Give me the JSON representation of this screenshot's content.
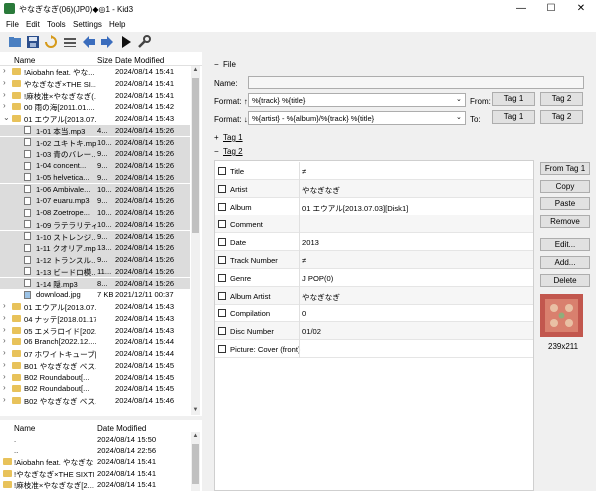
{
  "window": {
    "title": "やなぎなぎ(06)(JP0)◆◎1 - Kid3",
    "minimize": "—",
    "maximize": "☐",
    "close": "✕"
  },
  "menu": [
    "File",
    "Edit",
    "Tools",
    "Settings",
    "Help"
  ],
  "toolbar_icons": [
    "open-folder-icon",
    "save-icon",
    "revert-icon",
    "file-list-icon",
    "previous-icon",
    "next-icon",
    "play-icon",
    "settings-wrench-icon"
  ],
  "file_tree": {
    "headers": {
      "name": "Name",
      "size": "Size",
      "date": "Date Modified"
    },
    "rows": [
      {
        "name": "!Aiobahn feat. やな...",
        "size": "",
        "date": "2024/08/14 15:41",
        "type": "folder",
        "indent": 0,
        "expander": "›",
        "selected": false
      },
      {
        "name": "やなぎなぎ×THE SI...",
        "size": "",
        "date": "2024/08/14 15:41",
        "type": "folder",
        "indent": 0,
        "expander": "›",
        "selected": false
      },
      {
        "name": "!麻枝准×やなぎなぎ(...",
        "size": "",
        "date": "2024/08/14 15:41",
        "type": "folder",
        "indent": 0,
        "expander": "›",
        "selected": false
      },
      {
        "name": "00 雨の海[2011.01....",
        "size": "",
        "date": "2024/08/14 15:42",
        "type": "folder",
        "indent": 0,
        "expander": "›",
        "selected": false
      },
      {
        "name": "01 エウアル[2013.07....",
        "size": "",
        "date": "2024/08/14 15:43",
        "type": "folder",
        "indent": 0,
        "expander": "⌄",
        "selected": false
      },
      {
        "name": "1-01 本当.mp3",
        "size": "4...",
        "date": "2024/08/14 15:26",
        "type": "file",
        "indent": 1,
        "expander": "",
        "selected": true
      },
      {
        "name": "1-02 ユキトキ.mp3",
        "size": "10...",
        "date": "2024/08/14 15:26",
        "type": "file",
        "indent": 1,
        "expander": "",
        "selected": true
      },
      {
        "name": "1-03 青のバレー...",
        "size": "9...",
        "date": "2024/08/14 15:26",
        "type": "file",
        "indent": 1,
        "expander": "",
        "selected": true
      },
      {
        "name": "1-04 concent...",
        "size": "9...",
        "date": "2024/08/14 15:26",
        "type": "file",
        "indent": 1,
        "expander": "",
        "selected": true
      },
      {
        "name": "1-05 helvetica...",
        "size": "9...",
        "date": "2024/08/14 15:26",
        "type": "file",
        "indent": 1,
        "expander": "",
        "selected": true
      },
      {
        "name": "1-06 Ambivale...",
        "size": "10...",
        "date": "2024/08/14 15:26",
        "type": "file",
        "indent": 1,
        "expander": "",
        "selected": true
      },
      {
        "name": "1-07 euaru.mp3",
        "size": "9...",
        "date": "2024/08/14 15:26",
        "type": "file",
        "indent": 1,
        "expander": "",
        "selected": true
      },
      {
        "name": "1-08 Zoetrope...",
        "size": "10...",
        "date": "2024/08/14 15:26",
        "type": "file",
        "indent": 1,
        "expander": "",
        "selected": true
      },
      {
        "name": "1-09 ラテラリティ...",
        "size": "10...",
        "date": "2024/08/14 15:26",
        "type": "file",
        "indent": 1,
        "expander": "",
        "selected": true
      },
      {
        "name": "1-10 ストレンジ...",
        "size": "9...",
        "date": "2024/08/14 15:26",
        "type": "file",
        "indent": 1,
        "expander": "",
        "selected": true
      },
      {
        "name": "1-11 クオリア.mp3",
        "size": "13...",
        "date": "2024/08/14 15:26",
        "type": "file",
        "indent": 1,
        "expander": "",
        "selected": true
      },
      {
        "name": "1-12 トランスル...",
        "size": "9...",
        "date": "2024/08/14 15:26",
        "type": "file",
        "indent": 1,
        "expander": "",
        "selected": true
      },
      {
        "name": "1-13 ビードロ模...",
        "size": "11...",
        "date": "2024/08/14 15:26",
        "type": "file",
        "indent": 1,
        "expander": "",
        "selected": true
      },
      {
        "name": "1-14 隠.mp3",
        "size": "8...",
        "date": "2024/08/14 15:26",
        "type": "file",
        "indent": 1,
        "expander": "",
        "selected": true
      },
      {
        "name": "download.jpg",
        "size": "7 KB",
        "date": "2021/12/11 00:37",
        "type": "image",
        "indent": 1,
        "expander": "",
        "selected": false
      },
      {
        "name": "01 エウアル[2013.07....",
        "size": "",
        "date": "2024/08/14 15:43",
        "type": "folder",
        "indent": 0,
        "expander": "›",
        "selected": false
      },
      {
        "name": "04 ナッテ[2018.01.17]",
        "size": "",
        "date": "2024/08/14 15:43",
        "type": "folder",
        "indent": 0,
        "expander": "›",
        "selected": false
      },
      {
        "name": "05 エメラロイド[202...",
        "size": "",
        "date": "2024/08/14 15:43",
        "type": "folder",
        "indent": 0,
        "expander": "›",
        "selected": false
      },
      {
        "name": "06 Branch[2022.12....",
        "size": "",
        "date": "2024/08/14 15:44",
        "type": "folder",
        "indent": 0,
        "expander": "›",
        "selected": false
      },
      {
        "name": "07 ホワイトキューブ[2...",
        "size": "",
        "date": "2024/08/14 15:44",
        "type": "folder",
        "indent": 0,
        "expander": "›",
        "selected": false
      },
      {
        "name": "B01 やなぎなぎ ベス...",
        "size": "",
        "date": "2024/08/14 15:45",
        "type": "folder",
        "indent": 0,
        "expander": "›",
        "selected": false
      },
      {
        "name": "B02 Roundabout[...",
        "size": "",
        "date": "2024/08/14 15:45",
        "type": "folder",
        "indent": 0,
        "expander": "›",
        "selected": false
      },
      {
        "name": "B02 Roundabout[...",
        "size": "",
        "date": "2024/08/14 15:45",
        "type": "folder",
        "indent": 0,
        "expander": "›",
        "selected": false
      },
      {
        "name": "B02 やなぎなぎ ベス...",
        "size": "",
        "date": "2024/08/14 15:46",
        "type": "folder",
        "indent": 0,
        "expander": "›",
        "selected": false
      }
    ]
  },
  "dir_list": {
    "headers": {
      "name": "Name",
      "date": "Date Modified"
    },
    "rows": [
      {
        "name": ".",
        "date": "2024/08/14 15:50",
        "type": "none"
      },
      {
        "name": "..",
        "date": "2024/08/14 22:56",
        "type": "none"
      },
      {
        "name": "!Aiobahn feat. やなぎなぎ",
        "date": "2024/08/14 15:41",
        "type": "folder"
      },
      {
        "name": "!やなぎなぎ×THE SIXTH ...",
        "date": "2024/08/14 15:41",
        "type": "folder"
      },
      {
        "name": "!麻枝准×やなぎなぎ[2...",
        "date": "2024/08/14 15:41",
        "type": "folder"
      }
    ]
  },
  "file_section": {
    "collapse": "−",
    "title": "File",
    "name_label": "Name:",
    "name_value": "",
    "format_up_label": "Format: ↑",
    "format_up_value": "%{track} %{title}",
    "format_down_label": "Format: ↓",
    "format_down_value": "%{artist} - %{album}/%{track} %{title}",
    "from_label": "From:",
    "to_label": "To:",
    "from_tag1": "Tag 1",
    "from_tag2": "Tag 2",
    "to_tag1": "Tag 1",
    "to_tag2": "Tag 2"
  },
  "tag1_section": {
    "toggle": "+",
    "title": "Tag 1"
  },
  "tag2_section": {
    "toggle": "−",
    "title": "Tag 2"
  },
  "tag_fields": [
    {
      "name": "Title",
      "value": "≠"
    },
    {
      "name": "Artist",
      "value": "やなぎなぎ"
    },
    {
      "name": "Album",
      "value": "01 エウアル[2013.07.03][Disk1]"
    },
    {
      "name": "Comment",
      "value": ""
    },
    {
      "name": "Date",
      "value": "2013"
    },
    {
      "name": "Track Number",
      "value": "≠"
    },
    {
      "name": "Genre",
      "value": "J POP(0)"
    },
    {
      "name": "Album Artist",
      "value": "やなぎなぎ"
    },
    {
      "name": "Compilation",
      "value": "0"
    },
    {
      "name": "Disc Number",
      "value": "01/02"
    },
    {
      "name": "Picture: Cover (front)",
      "value": ""
    }
  ],
  "tag_buttons": {
    "from_tag1": "From Tag 1",
    "copy": "Copy",
    "paste": "Paste",
    "remove": "Remove",
    "edit": "Edit...",
    "add": "Add...",
    "delete": "Delete"
  },
  "cover": {
    "dimensions": "239x211",
    "color": "#c2574e"
  }
}
